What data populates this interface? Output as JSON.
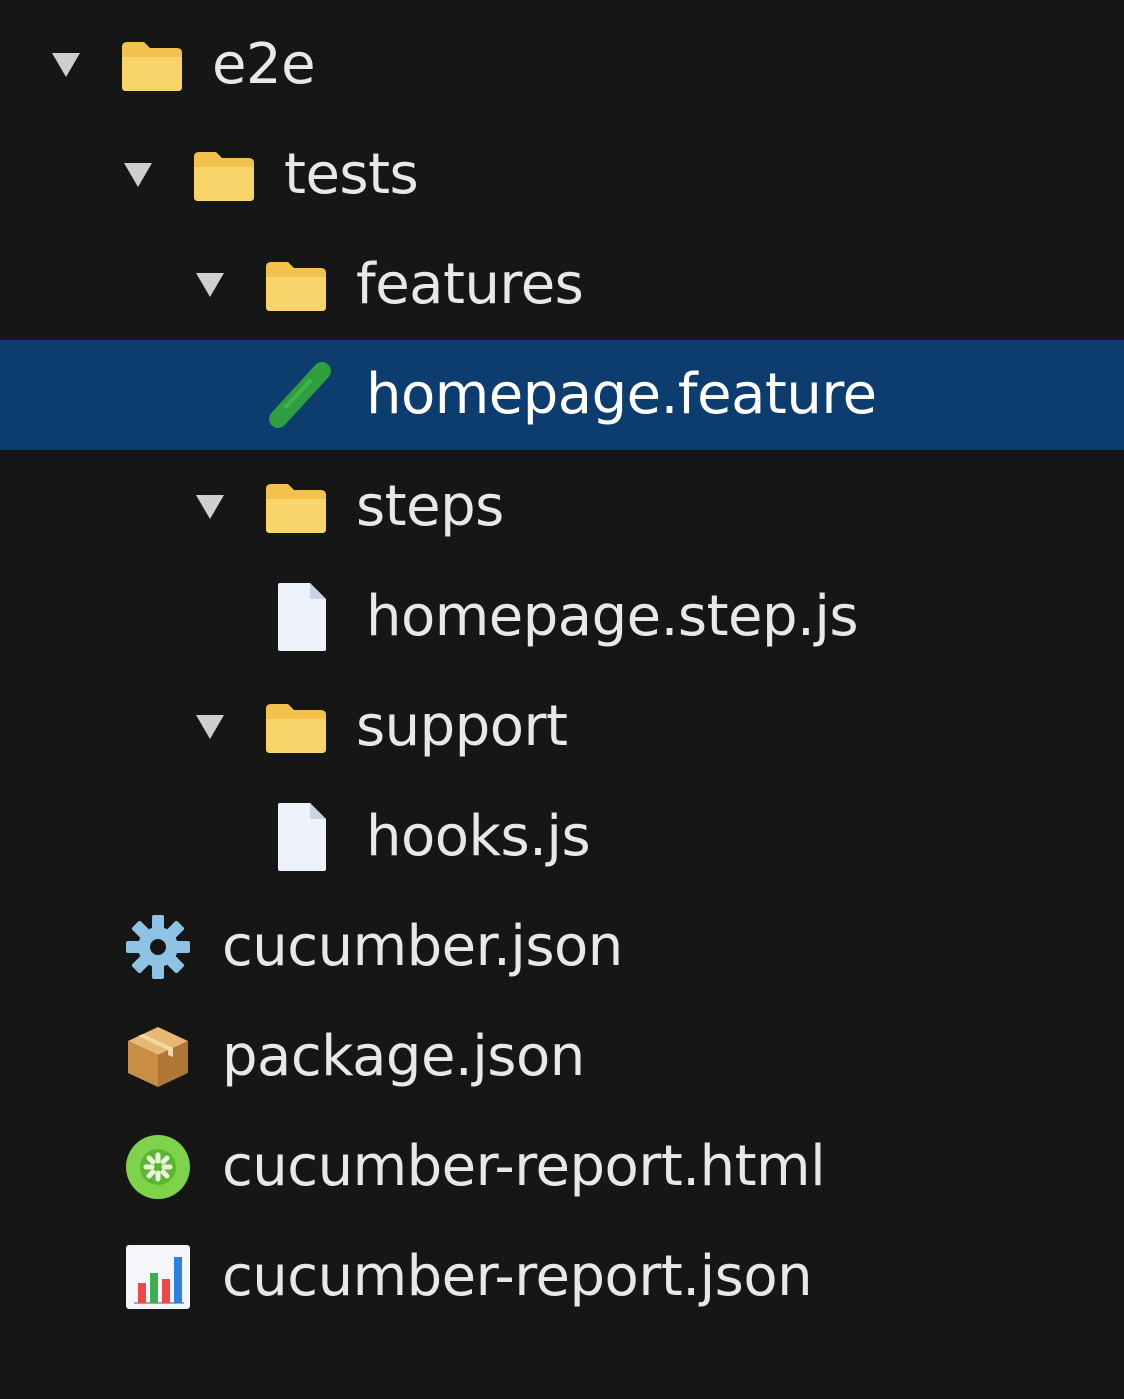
{
  "explorer": {
    "items": [
      {
        "label": "e2e",
        "icon": "folder-icon",
        "expanded": true,
        "depth": 0
      },
      {
        "label": "tests",
        "icon": "folder-icon",
        "expanded": true,
        "depth": 1
      },
      {
        "label": "features",
        "icon": "folder-icon",
        "expanded": true,
        "depth": 2
      },
      {
        "label": "homepage.feature",
        "icon": "cucumber-feature-icon",
        "selected": true,
        "depth": 3
      },
      {
        "label": "steps",
        "icon": "folder-icon",
        "expanded": true,
        "depth": 2
      },
      {
        "label": "homepage.step.js",
        "icon": "file-icon",
        "depth": 3
      },
      {
        "label": "support",
        "icon": "folder-icon",
        "expanded": true,
        "depth": 2
      },
      {
        "label": "hooks.js",
        "icon": "file-icon",
        "depth": 3
      },
      {
        "label": "cucumber.json",
        "icon": "gear-icon",
        "depth": 1
      },
      {
        "label": "package.json",
        "icon": "package-icon",
        "depth": 1
      },
      {
        "label": "cucumber-report.html",
        "icon": "cucumber-icon",
        "depth": 1
      },
      {
        "label": "cucumber-report.json",
        "icon": "bar-chart-icon",
        "depth": 1
      }
    ]
  },
  "colors": {
    "background": "#161616",
    "selection": "#0c3d6e",
    "folder": "#f2c14e",
    "cucumber": "#2e9e3e"
  }
}
